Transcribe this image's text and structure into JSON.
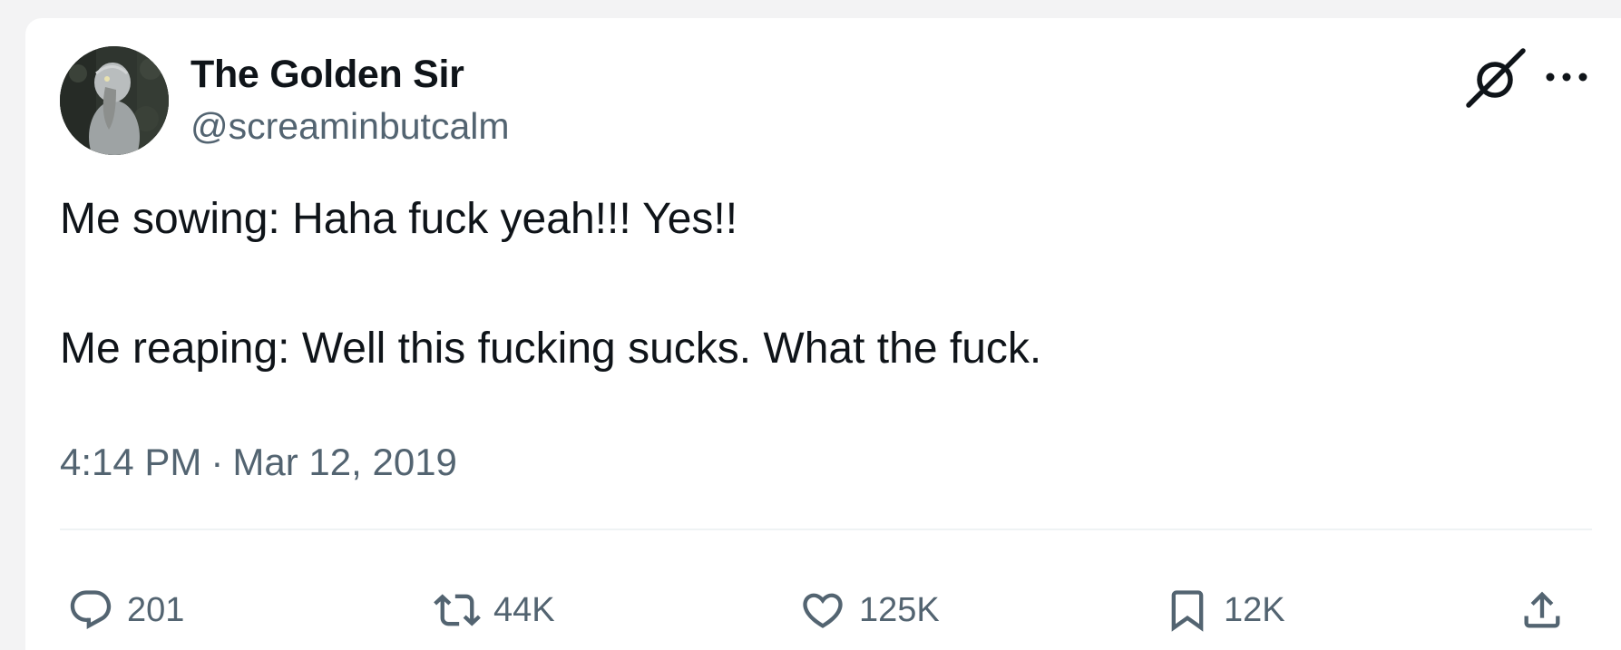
{
  "tweet": {
    "author": {
      "name": "The Golden Sir",
      "handle": "@screaminbutcalm",
      "avatar_icon": "shoebill-avatar"
    },
    "text_lines": [
      "Me sowing: Haha fuck yeah!!! Yes!!",
      "Me reaping: Well this fucking sucks. What the fuck."
    ],
    "time": "4:14 PM",
    "separator": "·",
    "date": "Mar 12, 2019",
    "header_icons": [
      "grok-icon",
      "more-icon"
    ]
  },
  "actions": {
    "reply": {
      "icon": "reply-icon",
      "count": "201"
    },
    "retweet": {
      "icon": "retweet-icon",
      "count": "44K"
    },
    "like": {
      "icon": "heart-icon",
      "count": "125K"
    },
    "bookmark": {
      "icon": "bookmark-icon",
      "count": "12K"
    },
    "share": {
      "icon": "share-icon"
    }
  },
  "colors": {
    "text_primary": "#0f1419",
    "text_secondary": "#536471",
    "divider": "#eff3f4",
    "background": "#ffffff"
  }
}
